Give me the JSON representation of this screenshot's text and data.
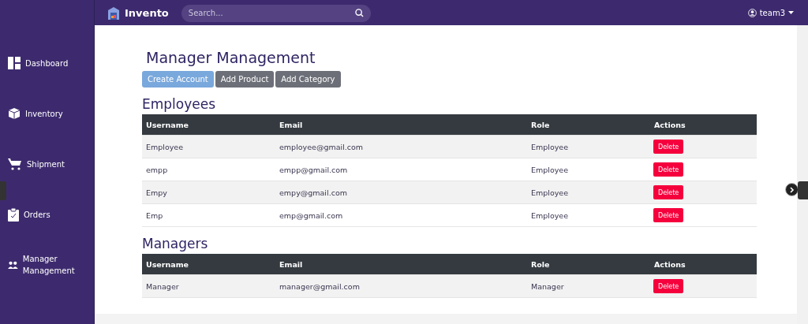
{
  "brand": {
    "name": "Invento"
  },
  "search": {
    "placeholder": "Search..."
  },
  "user": {
    "name": "team3"
  },
  "sidebar": {
    "items": [
      {
        "label": "Dashboard",
        "kind": "dashboard"
      },
      {
        "label": "Inventory",
        "kind": "inventory"
      },
      {
        "label": "Shipment",
        "kind": "shipment"
      },
      {
        "label": "Orders",
        "kind": "orders"
      },
      {
        "label": "Manager Management",
        "kind": "managers"
      }
    ]
  },
  "page": {
    "title": "Manager Management"
  },
  "actions": [
    {
      "label": "Create Account",
      "kind": "primary"
    },
    {
      "label": "Add Product",
      "kind": "secondary"
    },
    {
      "label": "Add Category",
      "kind": "secondary"
    }
  ],
  "sections": [
    {
      "title": "Employees",
      "columns": [
        "Username",
        "Email",
        "Role",
        "Actions"
      ],
      "rows": [
        {
          "username": "Employee",
          "email": "employee@gmail.com",
          "role": "Employee",
          "action": "Delete"
        },
        {
          "username": "empp",
          "email": "empp@gmail.com",
          "role": "Employee",
          "action": "Delete"
        },
        {
          "username": "Empy",
          "email": "empy@gmail.com",
          "role": "Employee",
          "action": "Delete"
        },
        {
          "username": "Emp",
          "email": "emp@gmail.com",
          "role": "Employee",
          "action": "Delete"
        }
      ]
    },
    {
      "title": "Managers",
      "columns": [
        "Username",
        "Email",
        "Role",
        "Actions"
      ],
      "rows": [
        {
          "username": "Manager",
          "email": "manager@gmail.com",
          "role": "Manager",
          "action": "Delete"
        }
      ]
    }
  ]
}
